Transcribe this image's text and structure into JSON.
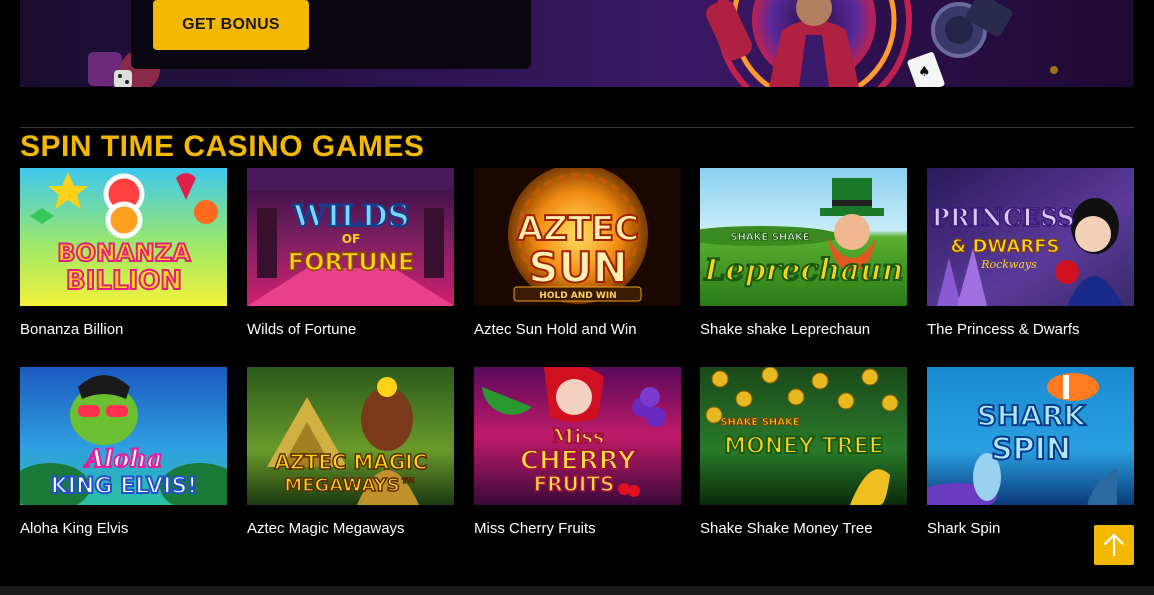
{
  "banner": {
    "button_label": "GET BONUS"
  },
  "section": {
    "title": "SPIN TIME CASINO GAMES"
  },
  "games": [
    {
      "name": "Bonanza Billion",
      "logo_lines": [
        "BONANZA",
        "BILLION"
      ],
      "theme": "candy"
    },
    {
      "name": "Wilds of Fortune",
      "logo_lines": [
        "WILDS",
        "OF",
        "FORTUNE"
      ],
      "theme": "casino"
    },
    {
      "name": "Aztec Sun Hold and Win",
      "logo_lines": [
        "AZTEC",
        "SUN",
        "HOLD AND WIN"
      ],
      "theme": "sun"
    },
    {
      "name": "Shake shake Leprechaun",
      "logo_lines": [
        "SHAKE SHAKE",
        "Leprechaun"
      ],
      "theme": "meadow"
    },
    {
      "name": "The Princess & Dwarfs",
      "logo_lines": [
        "PRINCESS",
        "& DWARFS",
        "Rockways"
      ],
      "theme": "fairy"
    },
    {
      "name": "Aloha King Elvis",
      "logo_lines": [
        "Aloha",
        "KING ELVIS!"
      ],
      "theme": "beach"
    },
    {
      "name": "Aztec Magic Megaways",
      "logo_lines": [
        "AZTEC MAGIC",
        "MEGAWAYS™"
      ],
      "theme": "jungle"
    },
    {
      "name": "Miss Cherry Fruits",
      "logo_lines": [
        "Miss",
        "CHERRY",
        "FRUITS"
      ],
      "theme": "fruits"
    },
    {
      "name": "Shake Shake Money Tree",
      "logo_lines": [
        "SHAKE SHAKE",
        "MONEY TREE"
      ],
      "theme": "tree"
    },
    {
      "name": "Shark Spin",
      "logo_lines": [
        "SHARK",
        "SPIN"
      ],
      "theme": "ocean"
    }
  ],
  "icons": {
    "scroll_top": "arrow-up-icon"
  },
  "colors": {
    "accent": "#f5b800",
    "background": "#000000",
    "text": "#ffffff"
  }
}
